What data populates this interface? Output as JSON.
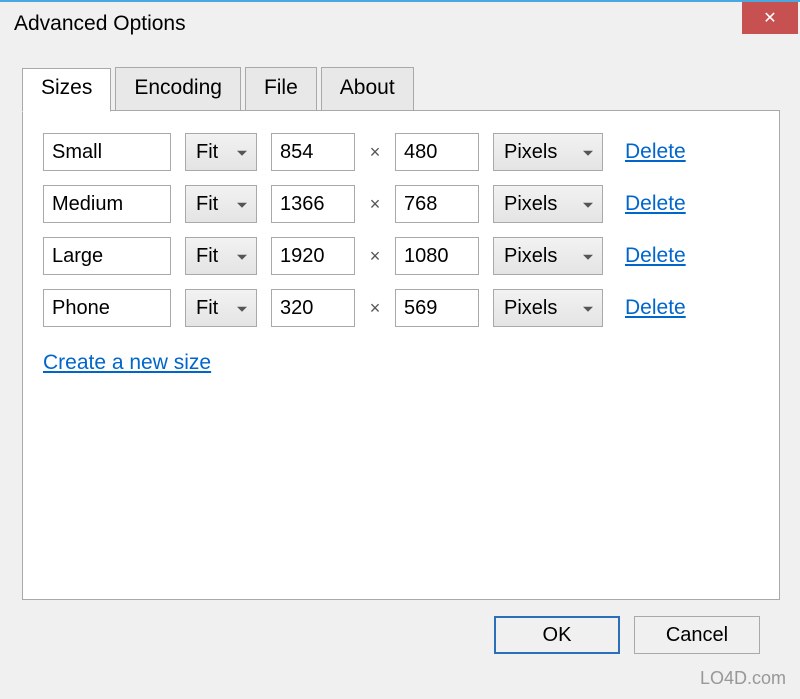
{
  "window": {
    "title": "Advanced Options",
    "close_glyph": "✕"
  },
  "tabs": [
    {
      "label": "Sizes",
      "active": true
    },
    {
      "label": "Encoding",
      "active": false
    },
    {
      "label": "File",
      "active": false
    },
    {
      "label": "About",
      "active": false
    }
  ],
  "size_rows": [
    {
      "name": "Small",
      "fit": "Fit",
      "width": "854",
      "height": "480",
      "unit": "Pixels",
      "delete": "Delete"
    },
    {
      "name": "Medium",
      "fit": "Fit",
      "width": "1366",
      "height": "768",
      "unit": "Pixels",
      "delete": "Delete"
    },
    {
      "name": "Large",
      "fit": "Fit",
      "width": "1920",
      "height": "1080",
      "unit": "Pixels",
      "delete": "Delete"
    },
    {
      "name": "Phone",
      "fit": "Fit",
      "width": "320",
      "height": "569",
      "unit": "Pixels",
      "delete": "Delete"
    }
  ],
  "times_symbol": "×",
  "create_link": "Create a new size",
  "buttons": {
    "ok": "OK",
    "cancel": "Cancel"
  },
  "watermark": "LO4D.com"
}
